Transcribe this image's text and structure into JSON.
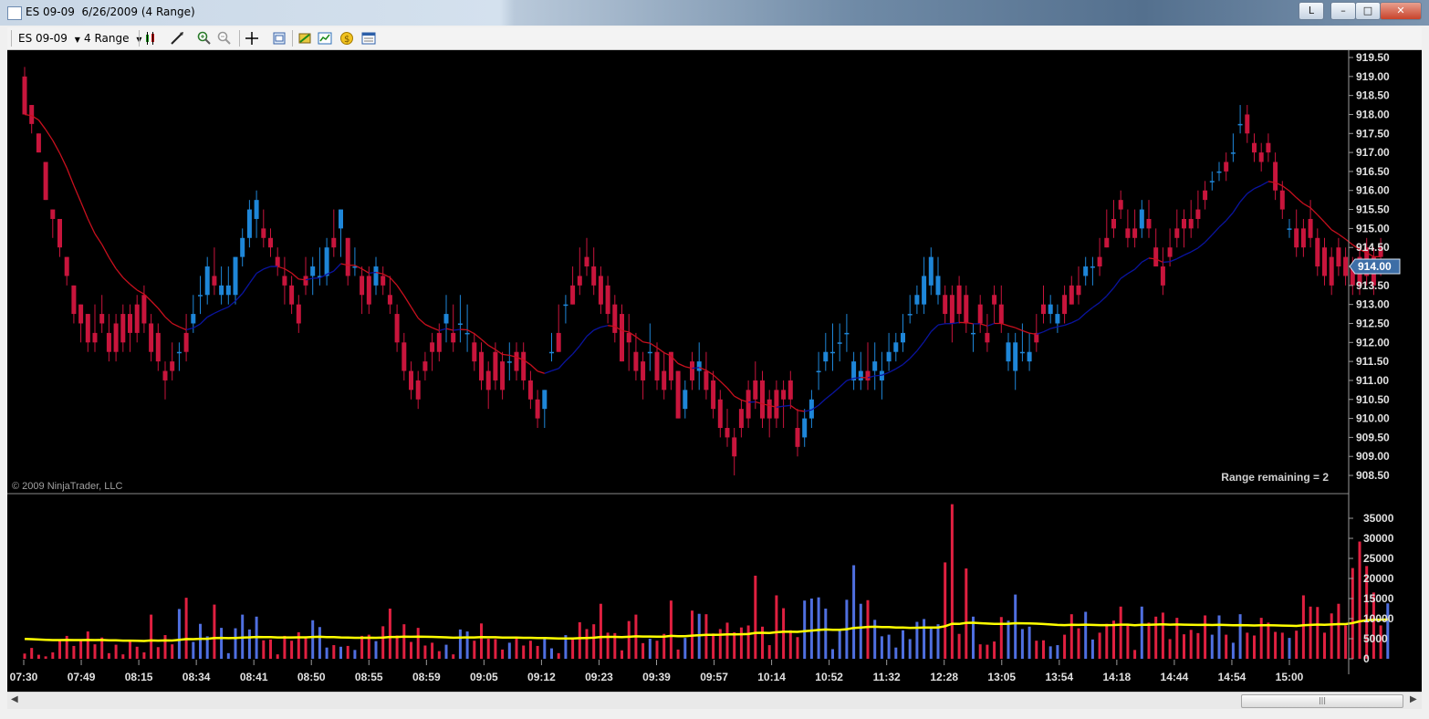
{
  "window": {
    "title": "ES 09-09  6/26/2009 (4 Range)",
    "btn_help": "L",
    "btn_min": "–",
    "btn_max": "□",
    "btn_close": "✕"
  },
  "toolbar": {
    "instrument": "ES 09-09",
    "period": "4 Range",
    "icons": [
      "bar-style-icon",
      "draw-pen-icon",
      "zoom-in-icon",
      "zoom-out-icon",
      "crosshair-icon",
      "properties-icon",
      "strategies-icon",
      "indicators-icon",
      "market-analyzer-icon",
      "data-box-icon"
    ]
  },
  "chart": {
    "copyright": "© 2009 NinjaTrader, LLC",
    "range_remaining": "Range remaining = 2",
    "last_price_label": "914.00",
    "price_ticks": [
      "919.50",
      "919.00",
      "918.50",
      "918.00",
      "917.50",
      "917.00",
      "916.50",
      "916.00",
      "915.50",
      "915.00",
      "914.50",
      "914.00",
      "913.50",
      "913.00",
      "912.50",
      "912.00",
      "911.50",
      "911.00",
      "910.50",
      "910.00",
      "909.50",
      "909.00",
      "908.50"
    ],
    "volume_ticks": [
      "35000",
      "30000",
      "25000",
      "20000",
      "15000",
      "10000",
      "5000",
      "0"
    ],
    "time_labels": [
      "07:30",
      "07:49",
      "08:15",
      "08:34",
      "08:41",
      "08:50",
      "08:55",
      "08:59",
      "09:05",
      "09:12",
      "09:23",
      "09:39",
      "09:57",
      "10:14",
      "10:52",
      "11:32",
      "12:28",
      "13:05",
      "13:54",
      "14:18",
      "14:44",
      "14:54",
      "15:00"
    ],
    "colors": {
      "up": "#1e86d8",
      "down": "#c8153c",
      "vol_up": "#4f6fe0",
      "vol_down": "#e02040",
      "ma_up": "#0a14a0",
      "ma_down": "#c8101e",
      "vol_ma": "#ffff00"
    }
  },
  "chart_data": {
    "type": "candlestick",
    "instrument": "ES 09-09",
    "bar_type": "4 Range",
    "date": "6/26/2009",
    "y_range": [
      908.25,
      919.75
    ],
    "volume_range": [
      0,
      38000
    ],
    "candles": [
      [
        919.0,
        919.25,
        918.0,
        918.0
      ],
      [
        918.25,
        918.25,
        917.5,
        917.75
      ],
      [
        917.5,
        917.5,
        917.0,
        917.0
      ],
      [
        916.75,
        916.75,
        915.75,
        915.75
      ],
      [
        915.5,
        915.5,
        914.75,
        915.25
      ],
      [
        915.25,
        915.25,
        914.25,
        914.5
      ],
      [
        914.25,
        914.25,
        913.5,
        913.75
      ],
      [
        913.5,
        913.5,
        912.5,
        912.75
      ],
      [
        913.0,
        913.0,
        912.0,
        912.5
      ],
      [
        912.75,
        912.75,
        911.75,
        912.0
      ],
      [
        912.25,
        913.0,
        911.75,
        912.0
      ],
      [
        912.75,
        913.25,
        912.25,
        912.5
      ],
      [
        912.25,
        912.75,
        911.5,
        911.75
      ],
      [
        912.5,
        912.75,
        911.5,
        911.75
      ],
      [
        912.75,
        913.0,
        911.75,
        912.0
      ],
      [
        912.75,
        913.0,
        911.75,
        912.25
      ],
      [
        913.0,
        913.25,
        912.0,
        912.25
      ],
      [
        913.25,
        913.5,
        912.25,
        912.5
      ],
      [
        912.5,
        912.75,
        911.5,
        911.75
      ],
      [
        912.25,
        912.5,
        911.25,
        911.5
      ],
      [
        911.25,
        911.5,
        910.5,
        911.0
      ],
      [
        911.5,
        912.0,
        911.0,
        911.25
      ],
      [
        911.75,
        912.0,
        911.25,
        911.75
      ],
      [
        912.25,
        912.75,
        911.5,
        911.75
      ],
      [
        912.5,
        913.25,
        912.25,
        912.75
      ],
      [
        913.25,
        913.75,
        912.75,
        913.25
      ],
      [
        913.25,
        914.25,
        913.0,
        914.0
      ],
      [
        913.75,
        914.5,
        913.25,
        913.5
      ],
      [
        913.25,
        914.0,
        913.0,
        913.5
      ],
      [
        913.25,
        914.0,
        913.0,
        913.5
      ],
      [
        913.25,
        914.25,
        913.0,
        914.25
      ],
      [
        914.25,
        915.0,
        914.0,
        914.75
      ],
      [
        914.75,
        915.75,
        914.5,
        915.5
      ],
      [
        915.25,
        916.0,
        914.75,
        915.75
      ],
      [
        915.0,
        915.5,
        914.5,
        914.75
      ],
      [
        914.75,
        915.0,
        914.25,
        914.5
      ],
      [
        914.25,
        914.5,
        913.75,
        914.0
      ],
      [
        913.75,
        914.25,
        913.0,
        913.5
      ],
      [
        913.5,
        913.75,
        912.75,
        913.0
      ],
      [
        913.0,
        913.25,
        912.25,
        912.5
      ],
      [
        913.75,
        914.25,
        913.25,
        913.5
      ],
      [
        913.75,
        914.25,
        913.25,
        914.0
      ],
      [
        913.75,
        914.5,
        913.5,
        913.75
      ],
      [
        913.75,
        914.75,
        913.5,
        914.5
      ],
      [
        914.75,
        915.5,
        914.25,
        914.5
      ],
      [
        915.0,
        915.5,
        914.25,
        915.5
      ],
      [
        914.75,
        914.75,
        913.5,
        913.75
      ],
      [
        914.0,
        914.5,
        913.75,
        914.0
      ],
      [
        913.75,
        914.0,
        912.75,
        913.25
      ],
      [
        913.75,
        914.0,
        912.75,
        913.0
      ],
      [
        913.5,
        914.25,
        913.25,
        914.0
      ],
      [
        913.75,
        914.0,
        913.25,
        913.5
      ],
      [
        913.25,
        913.75,
        912.75,
        913.0
      ],
      [
        912.75,
        913.0,
        911.75,
        912.0
      ],
      [
        912.0,
        912.25,
        911.0,
        911.25
      ],
      [
        911.25,
        911.5,
        910.5,
        910.75
      ],
      [
        911.0,
        911.25,
        910.25,
        910.5
      ],
      [
        911.5,
        911.75,
        911.0,
        911.25
      ],
      [
        912.0,
        912.25,
        911.25,
        911.75
      ],
      [
        912.25,
        912.5,
        911.5,
        911.75
      ],
      [
        912.5,
        913.25,
        912.0,
        912.75
      ],
      [
        912.25,
        913.0,
        911.75,
        912.0
      ],
      [
        912.5,
        913.25,
        912.0,
        912.5
      ],
      [
        912.25,
        913.0,
        911.75,
        912.25
      ],
      [
        912.0,
        912.25,
        911.25,
        911.5
      ],
      [
        911.75,
        912.0,
        910.75,
        911.0
      ],
      [
        911.25,
        911.5,
        910.25,
        910.75
      ],
      [
        911.75,
        912.0,
        910.75,
        911.0
      ],
      [
        911.5,
        911.75,
        910.5,
        910.75
      ],
      [
        911.5,
        912.0,
        911.0,
        911.5
      ],
      [
        911.75,
        912.0,
        911.0,
        911.25
      ],
      [
        911.75,
        912.0,
        910.75,
        911.0
      ],
      [
        911.0,
        911.25,
        910.25,
        910.5
      ],
      [
        910.5,
        910.75,
        909.75,
        910.0
      ],
      [
        910.25,
        910.75,
        909.75,
        910.75
      ],
      [
        911.75,
        912.25,
        911.5,
        911.75
      ],
      [
        912.25,
        913.0,
        911.75,
        911.75
      ],
      [
        913.0,
        913.25,
        912.5,
        913.0
      ],
      [
        913.5,
        914.0,
        913.0,
        913.0
      ],
      [
        913.75,
        914.5,
        913.25,
        913.5
      ],
      [
        914.25,
        914.75,
        913.75,
        914.0
      ],
      [
        914.0,
        914.5,
        913.25,
        913.5
      ],
      [
        913.75,
        914.0,
        912.75,
        913.0
      ],
      [
        913.5,
        913.75,
        912.5,
        912.75
      ],
      [
        913.0,
        913.25,
        912.0,
        912.25
      ],
      [
        912.75,
        913.0,
        911.5,
        911.5
      ],
      [
        912.25,
        912.75,
        911.25,
        912.0
      ],
      [
        911.75,
        912.25,
        911.0,
        911.25
      ],
      [
        911.5,
        911.75,
        910.5,
        911.0
      ],
      [
        911.75,
        912.5,
        911.25,
        911.75
      ],
      [
        911.75,
        912.0,
        910.75,
        911.0
      ],
      [
        911.25,
        911.75,
        910.5,
        910.75
      ],
      [
        911.75,
        911.75,
        910.75,
        911.0
      ],
      [
        911.25,
        911.25,
        910.0,
        910.0
      ],
      [
        910.25,
        911.0,
        910.0,
        910.75
      ],
      [
        911.5,
        911.75,
        910.75,
        911.0
      ],
      [
        911.25,
        912.0,
        910.75,
        911.5
      ],
      [
        911.25,
        911.75,
        910.5,
        910.75
      ],
      [
        911.0,
        911.25,
        910.0,
        910.25
      ],
      [
        910.5,
        910.75,
        909.5,
        909.75
      ],
      [
        909.75,
        910.25,
        909.25,
        909.5
      ],
      [
        909.5,
        909.75,
        908.5,
        909.0
      ],
      [
        910.25,
        910.5,
        909.5,
        909.75
      ],
      [
        910.75,
        911.0,
        909.75,
        910.0
      ],
      [
        911.0,
        911.5,
        910.25,
        910.5
      ],
      [
        911.0,
        911.25,
        909.75,
        910.0
      ],
      [
        910.5,
        910.75,
        909.5,
        910.0
      ],
      [
        910.75,
        911.0,
        909.75,
        910.0
      ],
      [
        910.75,
        911.0,
        909.75,
        910.5
      ],
      [
        911.0,
        911.25,
        910.25,
        910.5
      ],
      [
        909.75,
        910.25,
        909.0,
        909.25
      ],
      [
        909.5,
        910.25,
        909.25,
        910.0
      ],
      [
        910.0,
        910.75,
        909.75,
        910.5
      ],
      [
        911.25,
        911.75,
        910.75,
        911.25
      ],
      [
        911.5,
        912.25,
        911.25,
        911.75
      ],
      [
        911.75,
        912.5,
        911.25,
        911.75
      ],
      [
        912.0,
        912.5,
        911.5,
        912.0
      ],
      [
        912.25,
        912.75,
        911.75,
        912.25
      ],
      [
        911.0,
        911.75,
        910.75,
        911.5
      ],
      [
        911.0,
        911.75,
        910.75,
        911.25
      ],
      [
        911.25,
        912.0,
        910.75,
        911.0
      ],
      [
        911.25,
        912.0,
        910.75,
        911.5
      ],
      [
        911.0,
        911.75,
        910.5,
        911.25
      ],
      [
        911.5,
        912.25,
        911.25,
        911.75
      ],
      [
        911.75,
        912.25,
        911.5,
        912.0
      ],
      [
        912.0,
        912.75,
        911.75,
        912.25
      ],
      [
        912.75,
        913.25,
        912.5,
        912.75
      ],
      [
        913.0,
        913.5,
        912.75,
        913.25
      ],
      [
        913.0,
        914.25,
        912.75,
        913.75
      ],
      [
        913.5,
        914.5,
        913.25,
        914.25
      ],
      [
        913.25,
        914.25,
        913.0,
        913.75
      ],
      [
        913.25,
        913.5,
        912.5,
        912.75
      ],
      [
        913.25,
        913.5,
        912.0,
        912.5
      ],
      [
        913.5,
        913.75,
        912.5,
        912.75
      ],
      [
        913.25,
        913.5,
        912.25,
        912.5
      ],
      [
        912.25,
        912.5,
        911.75,
        912.25
      ],
      [
        913.0,
        913.25,
        912.25,
        912.5
      ],
      [
        912.25,
        912.75,
        911.75,
        912.0
      ],
      [
        913.25,
        913.5,
        912.5,
        913.0
      ],
      [
        913.0,
        913.5,
        912.25,
        912.5
      ],
      [
        911.5,
        912.25,
        911.25,
        912.0
      ],
      [
        911.25,
        912.25,
        910.75,
        912.0
      ],
      [
        911.75,
        912.5,
        911.5,
        911.75
      ],
      [
        911.5,
        912.25,
        911.25,
        911.75
      ],
      [
        912.25,
        912.75,
        911.75,
        912.0
      ],
      [
        913.0,
        913.5,
        912.5,
        912.75
      ],
      [
        912.75,
        913.25,
        912.5,
        913.0
      ],
      [
        912.5,
        913.0,
        912.25,
        912.75
      ],
      [
        913.25,
        913.5,
        912.5,
        912.75
      ],
      [
        913.5,
        913.75,
        913.0,
        913.0
      ],
      [
        913.5,
        914.0,
        913.0,
        913.25
      ],
      [
        913.75,
        914.25,
        913.5,
        914.0
      ],
      [
        914.0,
        914.25,
        913.5,
        914.0
      ],
      [
        914.25,
        914.75,
        913.75,
        914.0
      ],
      [
        914.75,
        915.5,
        914.5,
        914.5
      ],
      [
        915.25,
        915.75,
        914.75,
        915.0
      ],
      [
        915.75,
        916.0,
        915.25,
        915.5
      ],
      [
        915.0,
        915.5,
        914.5,
        914.75
      ],
      [
        915.0,
        915.5,
        914.5,
        914.75
      ],
      [
        915.0,
        915.75,
        914.75,
        915.5
      ],
      [
        915.25,
        915.75,
        914.75,
        915.0
      ],
      [
        914.5,
        915.0,
        914.0,
        914.0
      ],
      [
        914.0,
        914.5,
        913.25,
        913.5
      ],
      [
        914.5,
        915.0,
        914.0,
        914.25
      ],
      [
        915.0,
        915.5,
        914.5,
        914.75
      ],
      [
        915.25,
        915.5,
        914.5,
        915.0
      ],
      [
        915.25,
        915.75,
        914.75,
        915.0
      ],
      [
        915.5,
        916.0,
        915.0,
        915.25
      ],
      [
        916.0,
        916.25,
        915.5,
        915.75
      ],
      [
        916.25,
        916.5,
        916.0,
        916.25
      ],
      [
        916.5,
        916.75,
        916.25,
        916.5
      ],
      [
        916.75,
        917.0,
        916.25,
        916.5
      ],
      [
        917.0,
        917.5,
        916.75,
        917.0
      ],
      [
        917.75,
        918.25,
        917.5,
        917.75
      ],
      [
        918.0,
        918.25,
        917.25,
        917.5
      ],
      [
        917.25,
        917.5,
        916.75,
        917.0
      ],
      [
        917.0,
        917.25,
        916.5,
        916.75
      ],
      [
        917.25,
        917.5,
        916.75,
        917.0
      ],
      [
        916.75,
        917.0,
        915.75,
        916.0
      ],
      [
        916.0,
        916.25,
        915.25,
        915.5
      ],
      [
        915.0,
        915.25,
        914.75,
        915.0
      ],
      [
        915.0,
        915.5,
        914.25,
        914.5
      ],
      [
        915.0,
        915.25,
        914.25,
        914.5
      ],
      [
        915.25,
        915.75,
        914.5,
        914.75
      ],
      [
        914.75,
        915.0,
        913.75,
        914.0
      ],
      [
        914.5,
        914.75,
        913.5,
        913.75
      ],
      [
        914.25,
        914.5,
        913.25,
        913.5
      ],
      [
        914.5,
        914.75,
        913.75,
        914.0
      ],
      [
        914.25,
        914.5,
        913.5,
        913.75
      ],
      [
        914.0,
        914.25,
        913.25,
        913.5
      ],
      [
        914.25,
        914.5,
        913.25,
        913.5
      ],
      [
        914.5,
        914.75,
        913.5,
        913.75
      ],
      [
        914.25,
        914.5,
        913.25,
        913.5
      ],
      [
        914.5,
        914.75,
        913.75,
        914.25
      ]
    ],
    "volume": [
      1300,
      2700,
      1000,
      600,
      1600,
      4700,
      5700,
      3200,
      4600,
      6800,
      3600,
      5300,
      1400,
      3500,
      1100,
      4300,
      3000,
      1600,
      11000,
      2900,
      5900,
      3600,
      12400,
      15200,
      4200,
      8700,
      5600,
      13500,
      7700,
      1400,
      7600,
      11000,
      7300,
      10500,
      4600,
      4800,
      1100,
      5700,
      4500,
      6600,
      5300,
      9600,
      7900,
      2800,
      3400,
      3000,
      3200,
      2200,
      5700,
      6000,
      4400,
      8100,
      12500,
      5800,
      8600,
      4200,
      7700,
      3300,
      4000,
      1900,
      3500,
      1100,
      7300,
      6800,
      4500,
      8800,
      5000,
      4900,
      2300,
      4000,
      5000,
      3300,
      4500,
      3200,
      5000,
      2600,
      1400,
      5900,
      4800,
      9100,
      7400,
      8600,
      13700,
      6500,
      6400,
      2100,
      9400,
      11000,
      3900,
      5000,
      4500,
      6200,
      14500,
      2300,
      5200,
      12000,
      11200,
      11100,
      6300,
      7400,
      9000,
      6600,
      7800,
      8300,
      20700,
      8000,
      3400,
      15800,
      12600,
      7100,
      5400,
      14500,
      15000,
      15300,
      12500,
      2400,
      7500,
      14700,
      23300,
      13700,
      14600,
      9700,
      5600,
      6000,
      2800,
      7100,
      4900,
      9200,
      9900,
      7500,
      8600,
      24000,
      38500,
      6200,
      22500,
      10500,
      3600,
      3500,
      4300,
      10400,
      9500,
      16000,
      7400,
      8000,
      4500,
      4600,
      3100,
      3400,
      6000,
      11100,
      7600,
      11700,
      4800,
      6500,
      8700,
      9500,
      13000,
      8300,
      2200,
      13000,
      9000,
      10500,
      11500,
      4900,
      10200,
      6100,
      7200,
      6400,
      10800,
      6000,
      10800,
      6000,
      4000,
      11100,
      6500,
      5800,
      10200,
      9000,
      6700,
      6500,
      5200,
      7000,
      15800,
      13000,
      12900,
      6500,
      11300,
      13700,
      8300,
      22600,
      29200,
      23100,
      16500,
      8300,
      13800
    ],
    "moving_average": "vwma-colored",
    "volume_moving_average": "yellow line"
  }
}
